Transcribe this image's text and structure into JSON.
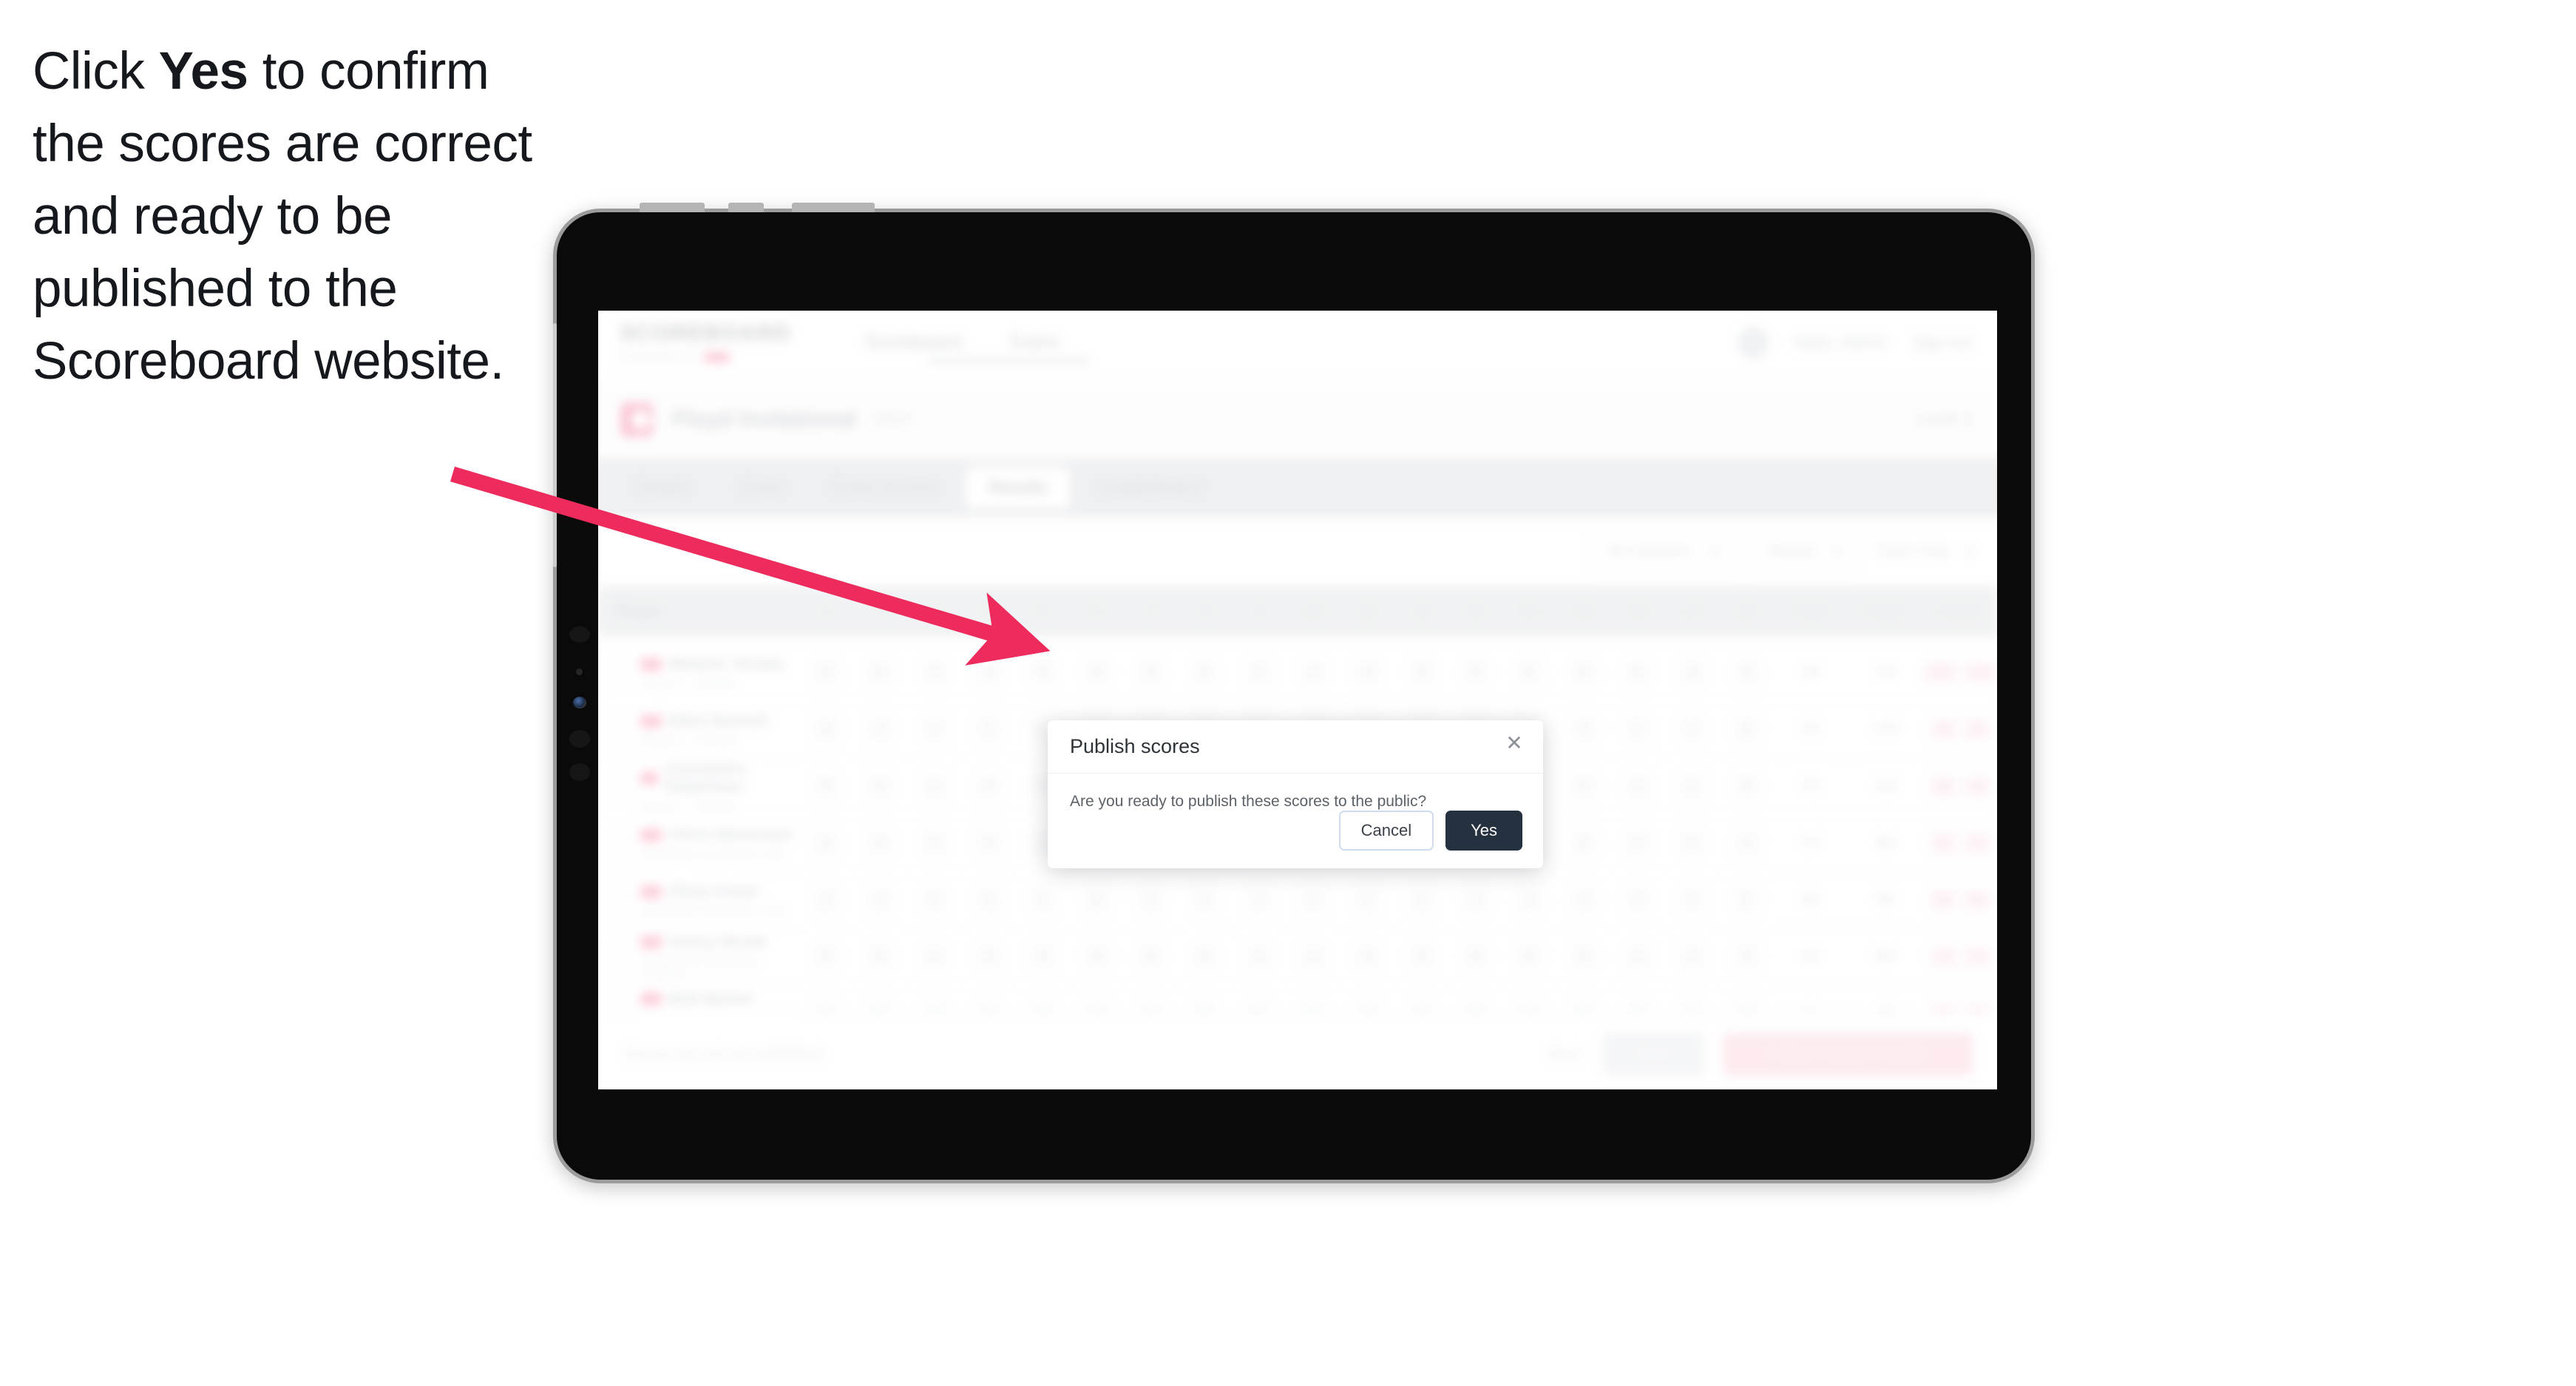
{
  "caption": {
    "part1": "Click ",
    "bold": "Yes",
    "part2": " to confirm the scores are correct and ready to be published to the Scoreboard website."
  },
  "annotation": {
    "arrow_color": "#ED2B5C",
    "arrow_start": "612,641",
    "arrow_end": "1382,869"
  },
  "device": {
    "frame_color": "#0a0a0a",
    "bezel_color": "#9c9c9c"
  },
  "app": {
    "nav": {
      "logo": "SCOREBOARD",
      "logo_sub": "POWERED BY",
      "links": [
        "Scoreboard",
        "Event"
      ],
      "right": {
        "avatar": "user-avatar",
        "items": [
          "Hello, Admin",
          "Sign out"
        ]
      }
    },
    "title_row": {
      "badge": "event-logo",
      "title": "Floyd Invitational",
      "subtitle": "2024",
      "right": "Level 3"
    },
    "tabs": [
      {
        "label": "Details",
        "active": false
      },
      {
        "label": "Draw",
        "active": false
      },
      {
        "label": "Enter Scores",
        "active": false
      },
      {
        "label": "Results",
        "active": true
      },
      {
        "label": "Leaderboard",
        "active": false
      }
    ],
    "filters": [
      {
        "label": "All Divisions",
        "type": "select"
      },
      {
        "label": "Round",
        "type": "select"
      },
      {
        "label": "Team Only",
        "type": "plain"
      }
    ],
    "table": {
      "headers_player": "Player",
      "headers_numbers": [
        "1",
        "2",
        "3",
        "4",
        "5",
        "6",
        "7",
        "8",
        "9",
        "10",
        "11",
        "12",
        "13",
        "14",
        "15",
        "16",
        "17",
        "18"
      ],
      "headers_wide": [
        "Total",
        "Place",
        "Points"
      ],
      "rows": [
        {
          "name": "Melanie Tanaka",
          "sub": "Region 4 - Oakdale",
          "cells": [
            "8",
            "8",
            "8",
            "8",
            "8",
            "9",
            "9",
            "8",
            "9",
            "8",
            "9",
            "8",
            "9",
            "8",
            "9",
            "8",
            "8",
            "9"
          ],
          "total": "68",
          "place": "1st",
          "points_a": "100",
          "points_b": "100"
        },
        {
          "name": "Ellen Rennell",
          "sub": "Region 2 - Fairfield",
          "cells": [
            "8",
            "8",
            "8",
            "8",
            "8",
            "8",
            "9",
            "8",
            "8",
            "8",
            "9",
            "8",
            "8",
            "8",
            "9",
            "8",
            "8",
            "8"
          ],
          "total": "66",
          "place": "2nd",
          "points_a": "95",
          "points_b": "95"
        },
        {
          "name": "Cassandra Robertson",
          "sub": "Region 1 - Bayside",
          "cells": [
            "8",
            "8",
            "8",
            "8",
            "8",
            "8",
            "8",
            "8",
            "8",
            "8",
            "8",
            "8",
            "8",
            "8",
            "8",
            "8",
            "8",
            "8"
          ],
          "total": "65",
          "place": "3rd",
          "points_a": "90",
          "points_b": "90"
        },
        {
          "name": "Chris Stevenson",
          "sub": "Northbrook Gymnastics Club",
          "cells": [
            "8",
            "8",
            "8",
            "8",
            "8",
            "8",
            "9",
            "8",
            "8",
            "8",
            "8",
            "8",
            "8",
            "8",
            "8",
            "8",
            "8",
            "8"
          ],
          "total": "64",
          "place": "4th",
          "points_a": "85",
          "points_b": "85"
        },
        {
          "name": "Olivia Grant",
          "sub": "Northbrook Gymnastics Club",
          "cells": [
            "8",
            "8",
            "8",
            "8",
            "8",
            "8",
            "9",
            "8",
            "8",
            "8",
            "8",
            "8",
            "9",
            "8",
            "8",
            "8",
            "8",
            "8"
          ],
          "total": "63",
          "place": "5th",
          "points_a": "80",
          "points_b": "80"
        },
        {
          "name": "Kasey Nicole",
          "sub": "Southbrook Gymnastics Academy",
          "cells": [
            "8",
            "8",
            "8",
            "8",
            "8",
            "8",
            "8",
            "8",
            "8",
            "8",
            "8",
            "8",
            "8",
            "8",
            "8",
            "8",
            "8",
            "8"
          ],
          "total": "62",
          "place": "6th",
          "points_a": "75",
          "points_b": "75"
        },
        {
          "name": "Bob Barker",
          "sub": "Southbrook Gymnastics Academy",
          "cells": [
            "8",
            "8",
            "8",
            "8",
            "8",
            "8",
            "9",
            "8",
            "8",
            "8",
            "8",
            "8",
            "8",
            "8",
            "8",
            "8",
            "8",
            "8"
          ],
          "total": "61",
          "place": "7th",
          "points_a": "70",
          "points_b": "70"
        }
      ]
    },
    "footer": {
      "note": "Scores are not yet published.",
      "link": "Back",
      "grey_button": "Save",
      "pink_button": "Publish scores to public"
    }
  },
  "modal": {
    "title": "Publish scores",
    "close_icon": "✕",
    "message": "Are you ready to publish these scores to the public?",
    "cancel_label": "Cancel",
    "yes_label": "Yes",
    "yes_bg": "#26313f"
  }
}
